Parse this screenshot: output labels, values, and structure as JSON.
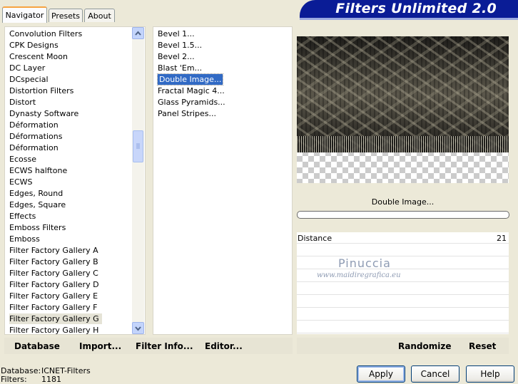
{
  "tabs": [
    {
      "label": "Navigator",
      "active": true
    },
    {
      "label": "Presets",
      "active": false
    },
    {
      "label": "About",
      "active": false
    }
  ],
  "title": "Filters Unlimited 2.0",
  "categories": [
    "Convolution Filters",
    "CPK Designs",
    "Crescent Moon",
    "DC Layer",
    "DCspecial",
    "Distortion Filters",
    "Distort",
    "Dynasty Software",
    "Déformation",
    "Déformations",
    "Déformation",
    "Ecosse",
    "ECWS halftone",
    "ECWS",
    "Edges, Round",
    "Edges, Square",
    "Effects",
    "Emboss Filters",
    "Emboss",
    "Filter Factory Gallery A",
    "Filter Factory Gallery B",
    "Filter Factory Gallery C",
    "Filter Factory Gallery D",
    "Filter Factory Gallery E",
    "Filter Factory Gallery F",
    "Filter Factory Gallery G",
    "Filter Factory Gallery H"
  ],
  "selected_category": "Filter Factory Gallery G",
  "filters": [
    "Bevel 1...",
    "Bevel 1.5...",
    "Bevel 2...",
    "Blast 'Em...",
    "Double Image...",
    "Fractal Magic 4...",
    "Glass Pyramids...",
    "Panel Stripes..."
  ],
  "selected_filter": "Double Image...",
  "preview_filter_name": "Double Image...",
  "params": [
    {
      "label": "Distance",
      "value": "21"
    }
  ],
  "watermark": {
    "name": "Pinuccia",
    "url": "www.maidiregrafica.eu"
  },
  "toolbar_left": {
    "database": "Database",
    "import": "Import...",
    "filter_info": "Filter Info...",
    "editor": "Editor..."
  },
  "toolbar_right": {
    "randomize": "Randomize",
    "reset": "Reset"
  },
  "status": {
    "database_label": "Database:",
    "database_value": "ICNET-Filters",
    "filters_label": "Filters:",
    "filters_value": "1181"
  },
  "buttons": {
    "apply": "Apply",
    "cancel": "Cancel",
    "help": "Help"
  },
  "colors": {
    "banner": "#0A1C96",
    "selection": "#316AC5",
    "window_bg": "#ECE9D8"
  }
}
